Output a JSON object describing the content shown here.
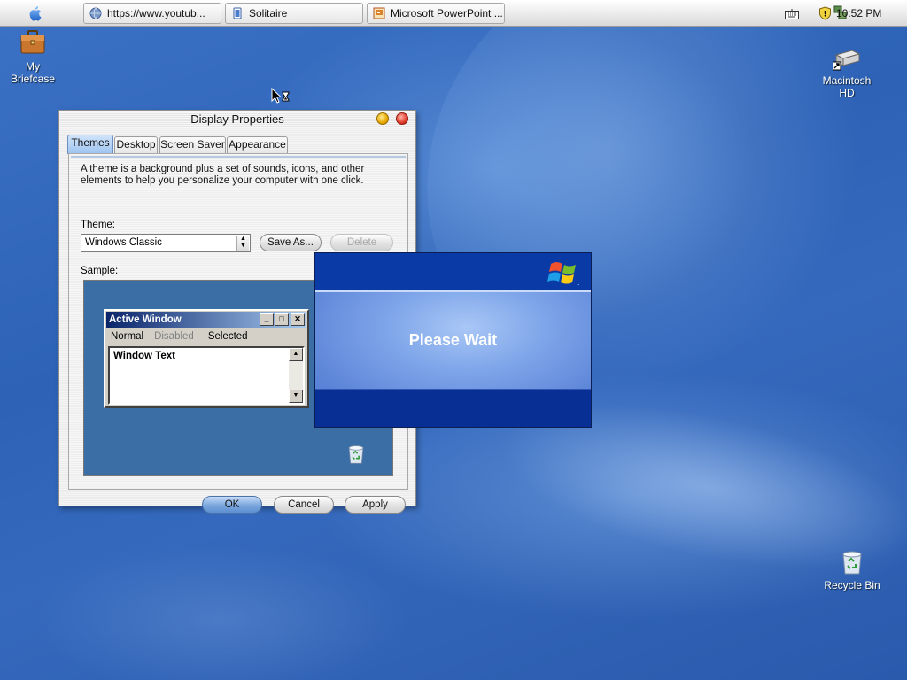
{
  "topbar": {
    "tasks": [
      {
        "label": "https://www.youtub...",
        "icon": "globe-icon"
      },
      {
        "label": "Solitaire",
        "icon": "solitaire-icon"
      },
      {
        "label": "Microsoft PowerPoint ...",
        "icon": "powerpoint-icon"
      }
    ],
    "clock": "10:52 PM"
  },
  "desktop": {
    "icons": [
      {
        "label_line1": "My",
        "label_line2": "Briefcase",
        "icon": "briefcase-icon"
      },
      {
        "label_line1": "Macintosh",
        "label_line2": "HD",
        "icon": "hard-drive-icon"
      },
      {
        "label_line1": "Recycle Bin",
        "label_line2": "",
        "icon": "recycle-bin-icon"
      }
    ]
  },
  "display_properties": {
    "title": "Display Properties",
    "tabs": [
      {
        "label": "Themes",
        "active": true
      },
      {
        "label": "Desktop",
        "active": false
      },
      {
        "label": "Screen Saver",
        "active": false
      },
      {
        "label": "Appearance",
        "active": false
      }
    ],
    "description": "A theme is a background plus a set of sounds, icons, and other elements to help you personalize your computer with one click.",
    "theme_label": "Theme:",
    "theme_value": "Windows Classic",
    "save_as_label": "Save As...",
    "delete_label": "Delete",
    "sample_label": "Sample:",
    "sample": {
      "window_title": "Active Window",
      "menu_normal": "Normal",
      "menu_disabled": "Disabled",
      "menu_selected": "Selected",
      "window_text": "Window Text"
    },
    "ok_label": "OK",
    "cancel_label": "Cancel",
    "apply_label": "Apply"
  },
  "please_wait": {
    "text": "Please Wait"
  },
  "colors": {
    "desktop_blue": "#2d63b8",
    "accent_blue": "#5d8ed1",
    "xp_blue": "#05339d"
  }
}
